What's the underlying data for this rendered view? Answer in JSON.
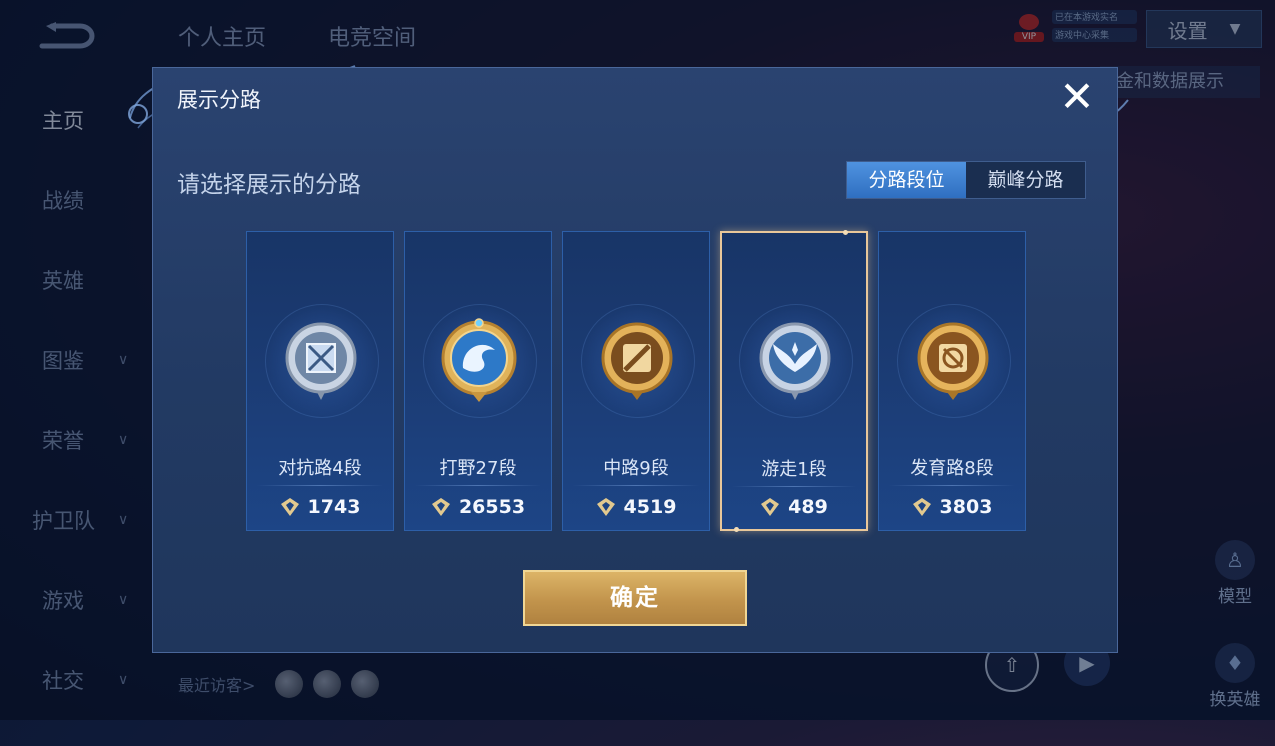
{
  "background": {
    "top_tabs": [
      "个人主页",
      "电竞空间"
    ],
    "vip": {
      "badge": "VIP",
      "line1": "已在本游戏实名",
      "line2": "游戏中心采集"
    },
    "settings_label": "设置",
    "data_display_label": "金和数据展示",
    "sidebar": [
      {
        "label": "主页",
        "active": true,
        "expandable": false
      },
      {
        "label": "战绩",
        "active": false,
        "expandable": false
      },
      {
        "label": "英雄",
        "active": false,
        "expandable": false
      },
      {
        "label": "图鉴",
        "active": false,
        "expandable": true
      },
      {
        "label": "荣誉",
        "active": false,
        "expandable": true
      },
      {
        "label": "护卫队",
        "active": false,
        "expandable": true
      },
      {
        "label": "游戏",
        "active": false,
        "expandable": true
      },
      {
        "label": "社交",
        "active": false,
        "expandable": true
      }
    ],
    "recent_visitors_label": "最近访客>",
    "right_panel": {
      "model_label": "模型",
      "switch_hero_label": "换英雄"
    }
  },
  "modal": {
    "title": "展示分路",
    "close_icon": "close-icon",
    "prompt": "请选择展示的分路",
    "toggle": {
      "options": [
        "分路段位",
        "巅峰分路"
      ],
      "selected": "分路段位"
    },
    "confirm_label": "确定",
    "cards": [
      {
        "emblem": "fight-lane-emblem",
        "tier": "silver",
        "name": "对抗路4段",
        "points": "1743",
        "selected": false
      },
      {
        "emblem": "jungle-dragon-emblem",
        "tier": "gold-blue",
        "name": "打野27段",
        "points": "26553",
        "selected": false
      },
      {
        "emblem": "mid-lane-emblem",
        "tier": "gold",
        "name": "中路9段",
        "points": "4519",
        "selected": false
      },
      {
        "emblem": "roam-wings-emblem",
        "tier": "silver",
        "name": "游走1段",
        "points": "489",
        "selected": true
      },
      {
        "emblem": "farm-lane-emblem",
        "tier": "gold",
        "name": "发育路8段",
        "points": "3803",
        "selected": false
      }
    ]
  },
  "colors": {
    "accent_blue": "#3f82d6",
    "gold": "#d3a95e",
    "selected_border": "#e8c79a"
  }
}
